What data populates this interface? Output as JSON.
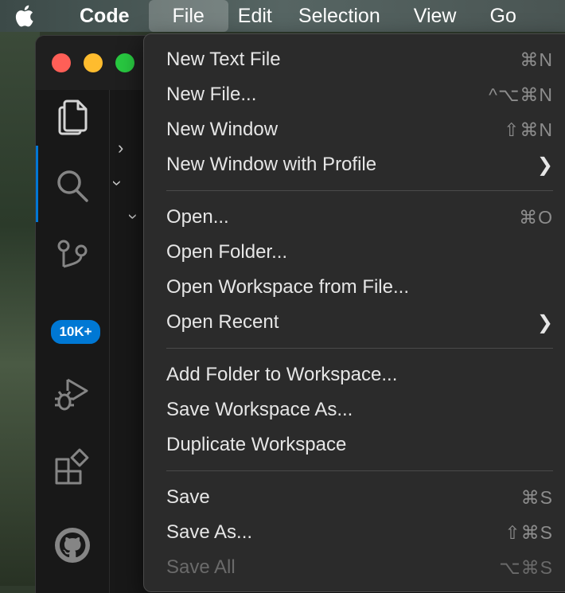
{
  "menubar": {
    "app": "Code",
    "menus": [
      "File",
      "Edit",
      "Selection",
      "View",
      "Go"
    ]
  },
  "activity": {
    "badge": "10K+",
    "icons": [
      "files-icon",
      "search-icon",
      "source-control-icon",
      "run-debug-icon",
      "extensions-icon",
      "github-icon"
    ]
  },
  "colors": {
    "accent": "#0078d4",
    "close": "#ff5f57",
    "minimize": "#febc2e",
    "maximize": "#28c840"
  },
  "file_menu": {
    "new_text_file": {
      "label": "New Text File",
      "shortcut": "⌘N"
    },
    "new_file": {
      "label": "New File...",
      "shortcut": "^⌥⌘N"
    },
    "new_window": {
      "label": "New Window",
      "shortcut": "⇧⌘N"
    },
    "new_window_profile": {
      "label": "New Window with Profile"
    },
    "open": {
      "label": "Open...",
      "shortcut": "⌘O"
    },
    "open_folder": {
      "label": "Open Folder..."
    },
    "open_workspace": {
      "label": "Open Workspace from File..."
    },
    "open_recent": {
      "label": "Open Recent"
    },
    "add_folder": {
      "label": "Add Folder to Workspace..."
    },
    "save_workspace_as": {
      "label": "Save Workspace As..."
    },
    "duplicate_workspace": {
      "label": "Duplicate Workspace"
    },
    "save": {
      "label": "Save",
      "shortcut": "⌘S"
    },
    "save_as": {
      "label": "Save As...",
      "shortcut": "⇧⌘S"
    },
    "save_all": {
      "label": "Save All",
      "shortcut": "⌥⌘S"
    }
  }
}
